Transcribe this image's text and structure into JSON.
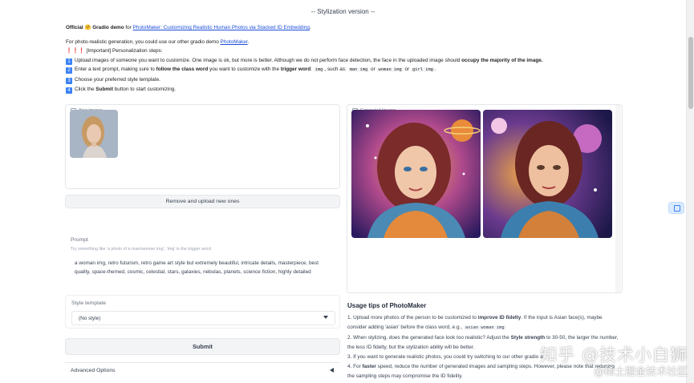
{
  "header": {
    "title": "-- Stylization version --"
  },
  "intro": {
    "official_prefix": "Official",
    "emoji": "🤗",
    "demo_word": "Gradio demo",
    "for_word": "for",
    "paper_link": "PhotoMaker: Customizing Realistic Human Photos via Stacked ID Embedding",
    "photoreal_text": "For photo-realistic generation, you could use our other gradio demo",
    "photoreal_link": "PhotoMaker",
    "important_marks": "❗❗❗",
    "important_label": "[Important]",
    "important_text": "Personalization steps:",
    "steps": [
      {
        "num": "1",
        "text": "Upload images of someone you want to customize. One image is ok, but more is better. Although we do not perform face detection, the face in the uploaded image should",
        "bold": "occupy the majority of the image."
      },
      {
        "num": "2",
        "pre": "Enter a text prompt, making sure to",
        "bold1": "follow the class word",
        "mid": "you want to customize with the",
        "bold2": "trigger word",
        "after": ": ",
        "c1": "img",
        "such": ", such as: ",
        "c2": "man img",
        "or1": " or ",
        "c3": "woman img",
        "or2": " or ",
        "c4": "girl img",
        "end": "."
      },
      {
        "num": "3",
        "text": "Choose your preferred style template."
      },
      {
        "num": "4",
        "pre": "Click the",
        "bold": "Submit",
        "post": "button to start customizing."
      }
    ]
  },
  "upload": {
    "label": "Your images",
    "remove_button": "Remove and upload new ones"
  },
  "prompt": {
    "label": "Prompt",
    "hint": "Try something like 'a photo of a man/woman img', 'img' is the trigger word.",
    "value": "a woman img, retro futurism, retro game art style but extremely beautiful, intricate details, masterpiece, best quality, space-themed, cosmic, celestial, stars, galaxies, nebulas, planets, science fiction, highly detailed"
  },
  "style": {
    "label": "Style template",
    "selected": "(No style)"
  },
  "submit": {
    "label": "Submit"
  },
  "advanced": {
    "label": "Advanced Options"
  },
  "gallery": {
    "label": "Generated Images"
  },
  "tips": {
    "title": "Usage tips of PhotoMaker",
    "t1_pre": "1. Upload more photos of the person to be customized to",
    "t1_bold": "improve ID fidelty",
    "t1_post": ". If the input is Asian face(s), maybe consider adding 'asian' before the class word, e.g.,",
    "t1_code": "asian woman img",
    "t2_pre": "2. When stylizing, does the generated face look too realistic? Adjust the",
    "t2_bold": "Style strength",
    "t2_post": "to 30-50, the larger the number, the less ID fidelty, but the stylization ability will be better.",
    "t3": "3. If you want to generate realistic photos, you could try switching to our other gradio a",
    "t4_pre": "4. For",
    "t4_bold": "faster",
    "t4_post": "speed, reduce the number of generated images and sampling steps. However, please note that reducing the sampling steps may compromise the ID fidelity."
  },
  "watermark": {
    "line1": "知乎 @技术小白狮",
    "line2": "@稀土掘金技术社区"
  }
}
